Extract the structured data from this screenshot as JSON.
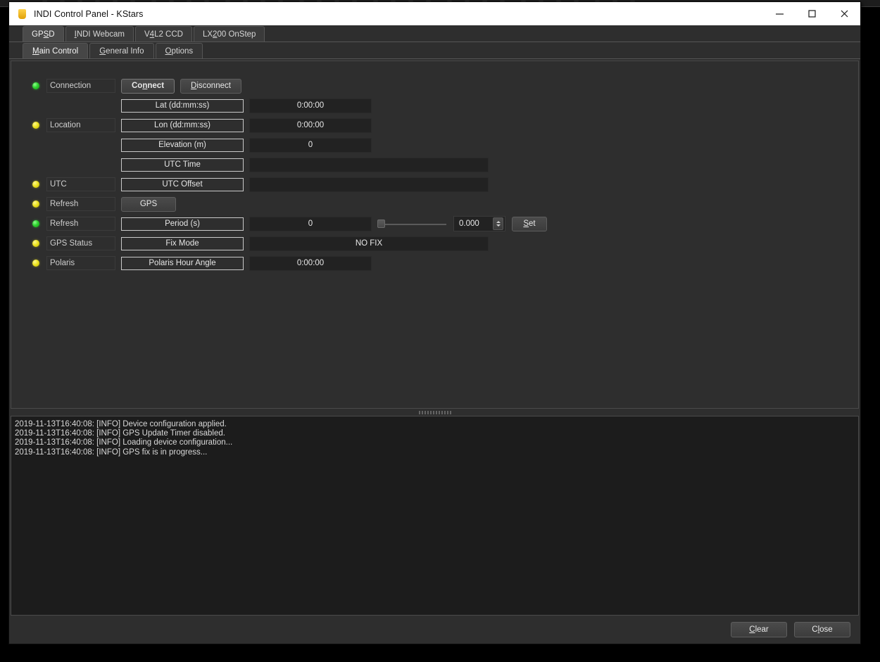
{
  "window": {
    "title": "INDI Control Panel - KStars",
    "app_icon": "indi-app-icon",
    "minimize": "minimize-icon",
    "maximize": "maximize-icon",
    "close": "close-icon"
  },
  "device_tabs": [
    {
      "label": "GPSD",
      "pre": "GP",
      "mn": "S",
      "post": "D",
      "selected": true
    },
    {
      "label": "INDI Webcam",
      "pre": "",
      "mn": "I",
      "post": "NDI Webcam",
      "selected": false
    },
    {
      "label": "V4L2 CCD",
      "pre": "V",
      "mn": "4",
      "post": "L2 CCD",
      "selected": false
    },
    {
      "label": "LX200 OnStep",
      "pre": "LX",
      "mn": "2",
      "post": "00 OnStep",
      "selected": false
    }
  ],
  "sub_tabs": [
    {
      "label": "Main Control",
      "pre": "",
      "mn": "M",
      "post": "ain Control",
      "selected": true
    },
    {
      "label": "General Info",
      "pre": "",
      "mn": "G",
      "post": "eneral Info",
      "selected": false
    },
    {
      "label": "Options",
      "pre": "",
      "mn": "O",
      "post": "ptions",
      "selected": false
    }
  ],
  "properties": {
    "connection": {
      "led": "green",
      "name": "Connection",
      "connect_label": "Connect",
      "connect_pre": "Co",
      "connect_mn": "n",
      "connect_post": "nect",
      "disconnect_label": "Disconnect",
      "disconnect_pre": "",
      "disconnect_mn": "D",
      "disconnect_post": "isconnect"
    },
    "location": {
      "led": "yellow",
      "name": "Location",
      "rows": [
        {
          "label": "Lat (dd:mm:ss)",
          "value": "0:00:00"
        },
        {
          "label": "Lon (dd:mm:ss)",
          "value": "0:00:00"
        },
        {
          "label": "Elevation (m)",
          "value": "0"
        }
      ]
    },
    "utc": {
      "led": "yellow",
      "name": "UTC",
      "rows": [
        {
          "label": "UTC Time",
          "value": ""
        },
        {
          "label": "UTC Offset",
          "value": ""
        }
      ]
    },
    "refresh_gps": {
      "led": "yellow",
      "name": "Refresh",
      "button_label": "GPS"
    },
    "refresh_period": {
      "led": "green",
      "name": "Refresh",
      "label": "Period (s)",
      "value": "0",
      "slider_value": 0,
      "spin_value": "0.000",
      "set_label": "Set",
      "set_pre": "",
      "set_mn": "S",
      "set_post": "et"
    },
    "gps_status": {
      "led": "yellow",
      "name": "GPS Status",
      "label": "Fix Mode",
      "value": "NO FIX"
    },
    "polaris": {
      "led": "yellow",
      "name": "Polaris",
      "label": "Polaris Hour Angle",
      "value": "0:00:00"
    }
  },
  "log": {
    "lines": [
      "2019-11-13T16:40:08: [INFO] Device configuration applied.",
      "2019-11-13T16:40:08: [INFO] GPS Update Timer disabled.",
      "2019-11-13T16:40:08: [INFO] Loading device configuration...",
      "2019-11-13T16:40:08: [INFO] GPS fix is in progress..."
    ]
  },
  "footer": {
    "clear_label": "Clear",
    "clear_pre": "",
    "clear_mn": "C",
    "clear_post": "lear",
    "close_label": "Close",
    "close_pre": "C",
    "close_mn": "l",
    "close_post": "ose"
  },
  "colors": {
    "led_green": "#2fd22f",
    "led_yellow": "#ece323",
    "panel_bg": "#2e2e2e",
    "log_bg": "#1c1c1c",
    "field_bg": "#222222"
  }
}
